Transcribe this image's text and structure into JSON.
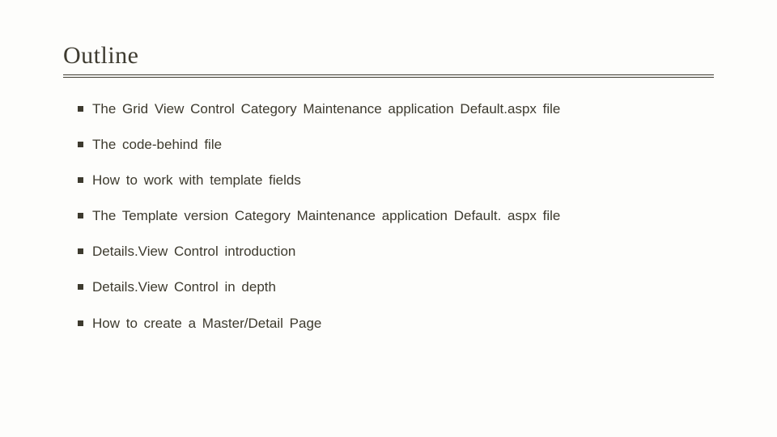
{
  "title": "Outline",
  "items": [
    "The Grid View Control Category Maintenance application Default.aspx file",
    "The code-behind file",
    "How to work with template fields",
    "The Template version Category Maintenance application Default. aspx file",
    "Details.View Control introduction",
    "Details.View Control in depth",
    "How to create a Master/Detail Page"
  ]
}
